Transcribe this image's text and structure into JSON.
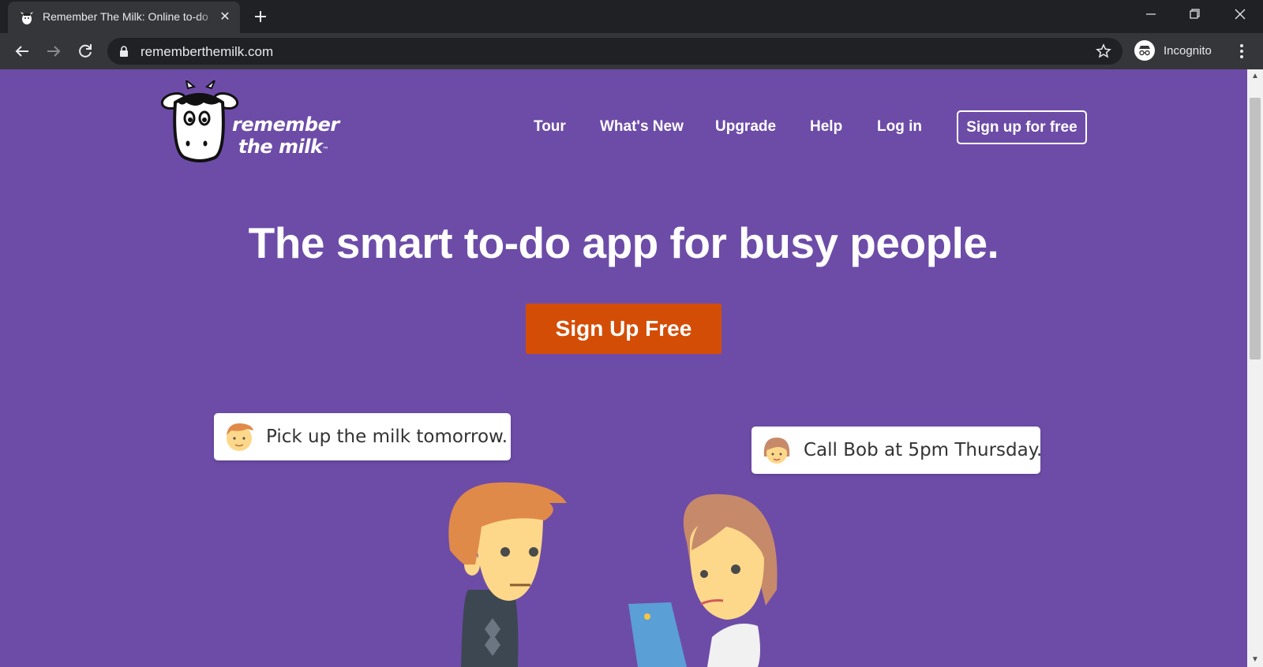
{
  "browser": {
    "tab_title": "Remember The Milk: Online to-do",
    "url": "rememberthemilk.com",
    "profile_label": "Incognito",
    "icons": [
      "cow-favicon",
      "close-icon",
      "plus-icon",
      "minimize-icon",
      "restore-icon",
      "window-close-icon",
      "back-icon",
      "forward-icon",
      "reload-icon",
      "lock-icon",
      "star-icon",
      "incognito-icon",
      "more-icon"
    ]
  },
  "site": {
    "logo_text_1": "remember",
    "logo_text_2": "the milk",
    "logo_tm": "™",
    "nav": {
      "tour": "Tour",
      "whats_new": "What's New",
      "upgrade": "Upgrade",
      "help": "Help",
      "login": "Log in",
      "signup": "Sign up for free"
    },
    "headline": "The smart to-do app for busy people.",
    "cta": "Sign Up Free",
    "bubbles": [
      {
        "text": "Pick up the milk tomorrow."
      },
      {
        "text": "Call Bob at 5pm Thursday."
      }
    ]
  },
  "colors": {
    "page_bg": "#6d4ca8",
    "cta_bg": "#d44d06",
    "chrome_dark": "#202124",
    "chrome_toolbar": "#35363a"
  }
}
